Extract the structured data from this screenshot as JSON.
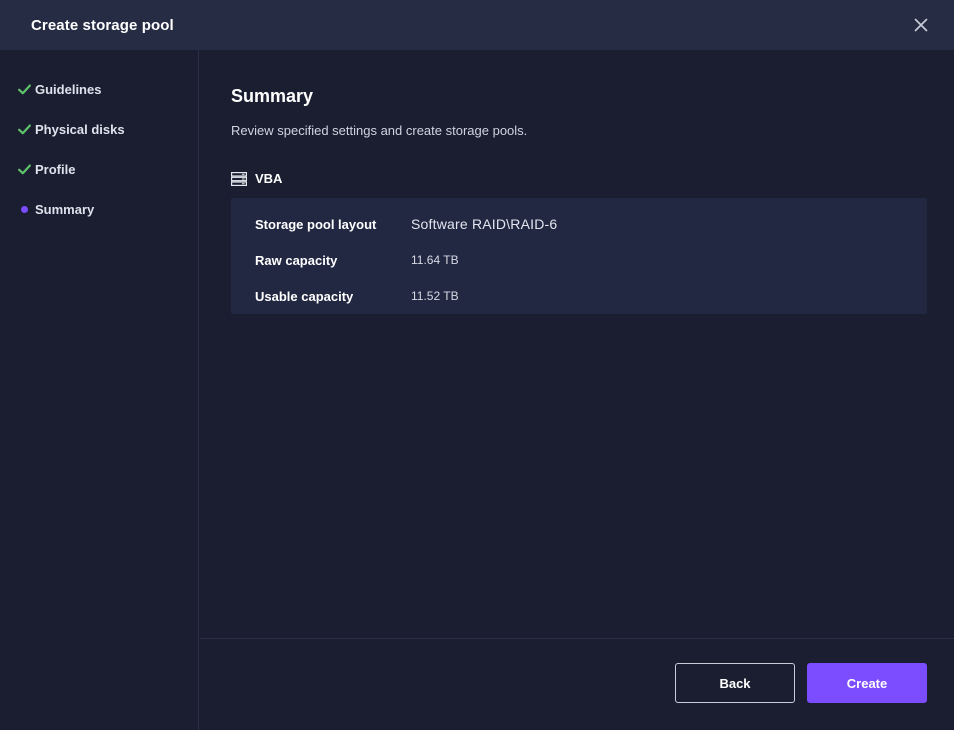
{
  "dialog": {
    "title": "Create storage pool",
    "close_icon": "close-icon"
  },
  "sidebar": {
    "steps": [
      {
        "label": "Guidelines",
        "status": "done",
        "icon": "check-icon"
      },
      {
        "label": "Physical disks",
        "status": "done",
        "icon": "check-icon"
      },
      {
        "label": "Profile",
        "status": "done",
        "icon": "check-icon"
      },
      {
        "label": "Summary",
        "status": "current",
        "icon": "current-step-dot-icon"
      }
    ]
  },
  "main": {
    "title": "Summary",
    "description": "Review specified settings and create storage pools.",
    "server": {
      "icon": "server-icon",
      "name": "VBA"
    },
    "summary": [
      {
        "label": "Storage pool layout",
        "value": "Software RAID\\RAID-6"
      },
      {
        "label": "Raw capacity",
        "value": "11.64 TB"
      },
      {
        "label": "Usable capacity",
        "value": "11.52 TB"
      }
    ]
  },
  "footer": {
    "back_label": "Back",
    "create_label": "Create"
  },
  "colors": {
    "accent": "#7c4dff",
    "check": "#5fc36b",
    "header_bg": "#262c43",
    "body_bg": "#1a1e30",
    "card_bg": "#232842"
  }
}
